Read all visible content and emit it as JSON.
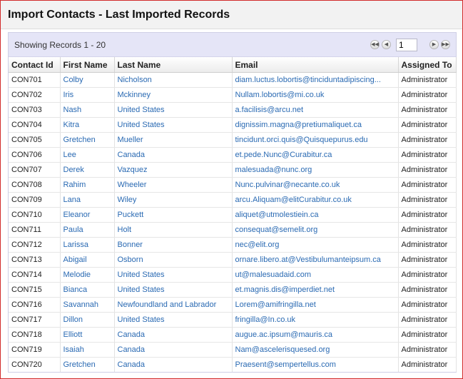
{
  "window": {
    "title": "Import Contacts - Last Imported Records"
  },
  "toolbar": {
    "showing": "Showing Records 1 - 20",
    "page": "1"
  },
  "columns": [
    "Contact Id",
    "First Name",
    "Last Name",
    "Email",
    "Assigned To"
  ],
  "rows": [
    {
      "id": "CON701",
      "first": "Colby",
      "last": "Nicholson",
      "email": "diam.luctus.lobortis@tinciduntadipiscing...",
      "assigned": "Administrator"
    },
    {
      "id": "CON702",
      "first": "Iris",
      "last": "Mckinney",
      "email": "Nullam.lobortis@mi.co.uk",
      "assigned": "Administrator"
    },
    {
      "id": "CON703",
      "first": "Nash",
      "last": "United States",
      "email": "a.facilisis@arcu.net",
      "assigned": "Administrator"
    },
    {
      "id": "CON704",
      "first": "Kitra",
      "last": "United States",
      "email": "dignissim.magna@pretiumaliquet.ca",
      "assigned": "Administrator"
    },
    {
      "id": "CON705",
      "first": "Gretchen",
      "last": "Mueller",
      "email": "tincidunt.orci.quis@Quisquepurus.edu",
      "assigned": "Administrator"
    },
    {
      "id": "CON706",
      "first": "Lee",
      "last": "Canada",
      "email": "et.pede.Nunc@Curabitur.ca",
      "assigned": "Administrator"
    },
    {
      "id": "CON707",
      "first": "Derek",
      "last": "Vazquez",
      "email": "malesuada@nunc.org",
      "assigned": "Administrator"
    },
    {
      "id": "CON708",
      "first": "Rahim",
      "last": "Wheeler",
      "email": "Nunc.pulvinar@necante.co.uk",
      "assigned": "Administrator"
    },
    {
      "id": "CON709",
      "first": "Lana",
      "last": "Wiley",
      "email": "arcu.Aliquam@elitCurabitur.co.uk",
      "assigned": "Administrator"
    },
    {
      "id": "CON710",
      "first": "Eleanor",
      "last": "Puckett",
      "email": "aliquet@utmolestiein.ca",
      "assigned": "Administrator"
    },
    {
      "id": "CON711",
      "first": "Paula",
      "last": "Holt",
      "email": "consequat@semelit.org",
      "assigned": "Administrator"
    },
    {
      "id": "CON712",
      "first": "Larissa",
      "last": "Bonner",
      "email": "nec@elit.org",
      "assigned": "Administrator"
    },
    {
      "id": "CON713",
      "first": "Abigail",
      "last": "Osborn",
      "email": "ornare.libero.at@Vestibulumanteipsum.ca",
      "assigned": "Administrator"
    },
    {
      "id": "CON714",
      "first": "Melodie",
      "last": "United States",
      "email": "ut@malesuadaid.com",
      "assigned": "Administrator"
    },
    {
      "id": "CON715",
      "first": "Bianca",
      "last": "United States",
      "email": "et.magnis.dis@imperdiet.net",
      "assigned": "Administrator"
    },
    {
      "id": "CON716",
      "first": "Savannah",
      "last": "Newfoundland and Labrador",
      "email": "Lorem@amifringilla.net",
      "assigned": "Administrator"
    },
    {
      "id": "CON717",
      "first": "Dillon",
      "last": "United States",
      "email": "fringilla@In.co.uk",
      "assigned": "Administrator"
    },
    {
      "id": "CON718",
      "first": "Elliott",
      "last": "Canada",
      "email": "augue.ac.ipsum@mauris.ca",
      "assigned": "Administrator"
    },
    {
      "id": "CON719",
      "first": "Isaiah",
      "last": "Canada",
      "email": "Nam@ascelerisquesed.org",
      "assigned": "Administrator"
    },
    {
      "id": "CON720",
      "first": "Gretchen",
      "last": "Canada",
      "email": "Praesent@sempertellus.com",
      "assigned": "Administrator"
    }
  ],
  "icons": {
    "first_page": "first-page-icon",
    "prev_page": "prev-page-icon",
    "next_page": "next-page-icon",
    "last_page": "last-page-icon"
  },
  "colors": {
    "window_border": "#d22b2b",
    "link": "#2a6ab3",
    "toolbar_bg": "#e5e5f7"
  }
}
